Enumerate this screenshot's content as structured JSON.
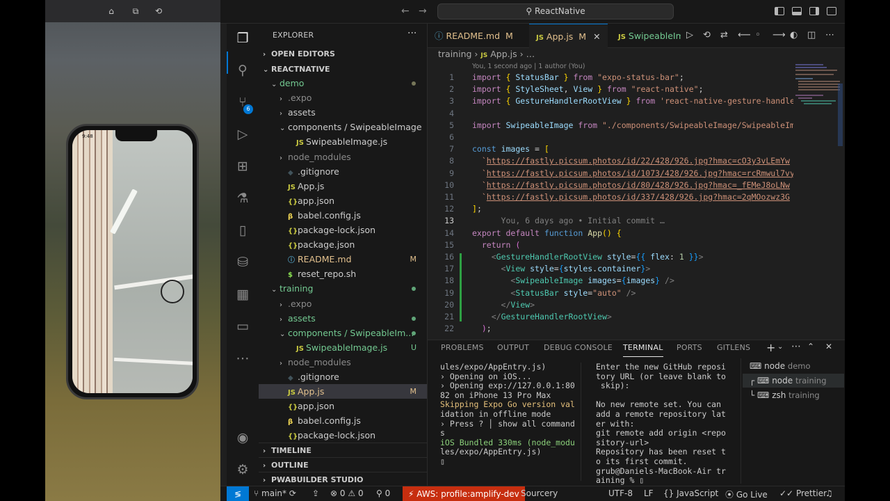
{
  "window": {
    "search_text": "ReactNative"
  },
  "simulator": {
    "status_time": "9:48"
  },
  "activity": {
    "scm_badge": "6"
  },
  "explorer": {
    "title": "EXPLORER",
    "more": "···",
    "open_editors": "OPEN EDITORS",
    "root": "REACTNATIVE",
    "rows": [
      {
        "label": "demo",
        "type": "folder",
        "open": true,
        "indent": 0,
        "color": "#73c991",
        "dot": "y"
      },
      {
        "label": ".expo",
        "type": "folder",
        "open": false,
        "indent": 1,
        "color": "#8b8b8b"
      },
      {
        "label": "assets",
        "type": "folder",
        "open": false,
        "indent": 1,
        "color": "#cccccc"
      },
      {
        "label": "components",
        "label2": " / SwipeableImage",
        "type": "folder",
        "open": true,
        "indent": 1,
        "color": "#cccccc"
      },
      {
        "label": "SwipeableImage.js",
        "type": "js",
        "indent": 2,
        "color": "#cccccc"
      },
      {
        "label": "node_modules",
        "type": "folder",
        "open": false,
        "indent": 1,
        "color": "#8b8b8b"
      },
      {
        "label": ".gitignore",
        "type": "git",
        "indent": 1,
        "color": "#cccccc"
      },
      {
        "label": "App.js",
        "type": "js",
        "indent": 1,
        "color": "#cccccc"
      },
      {
        "label": "app.json",
        "type": "json",
        "indent": 1,
        "color": "#cccccc"
      },
      {
        "label": "babel.config.js",
        "type": "babel",
        "indent": 1,
        "color": "#cccccc"
      },
      {
        "label": "package-lock.json",
        "type": "json",
        "indent": 1,
        "color": "#cccccc"
      },
      {
        "label": "package.json",
        "type": "json",
        "indent": 1,
        "color": "#cccccc"
      },
      {
        "label": "README.md",
        "type": "md",
        "indent": 1,
        "color": "#e2c08d",
        "badge": "M"
      },
      {
        "label": "reset_repo.sh",
        "type": "sh",
        "indent": 1,
        "color": "#cccccc"
      },
      {
        "label": "training",
        "type": "folder",
        "open": true,
        "indent": 0,
        "color": "#73c991",
        "dot": "g"
      },
      {
        "label": ".expo",
        "type": "folder",
        "open": false,
        "indent": 1,
        "color": "#8b8b8b"
      },
      {
        "label": "assets",
        "type": "folder",
        "open": false,
        "indent": 1,
        "color": "#73c991",
        "dot": "g"
      },
      {
        "label": "components",
        "label2": " / SwipeableIm...",
        "type": "folder",
        "open": true,
        "indent": 1,
        "color": "#73c991",
        "dot": "g"
      },
      {
        "label": "SwipeableImage.js",
        "type": "js",
        "indent": 2,
        "color": "#73c991",
        "badge": "U"
      },
      {
        "label": "node_modules",
        "type": "folder",
        "open": false,
        "indent": 1,
        "color": "#8b8b8b"
      },
      {
        "label": ".gitignore",
        "type": "git",
        "indent": 1,
        "color": "#cccccc"
      },
      {
        "label": "App.js",
        "type": "js",
        "indent": 1,
        "color": "#e2c08d",
        "badge": "M",
        "selected": true
      },
      {
        "label": "app.json",
        "type": "json",
        "indent": 1,
        "color": "#cccccc"
      },
      {
        "label": "babel.config.js",
        "type": "babel",
        "indent": 1,
        "color": "#cccccc"
      },
      {
        "label": "package-lock.json",
        "type": "json",
        "indent": 1,
        "color": "#cccccc"
      }
    ],
    "timeline": "TIMELINE",
    "outline": "OUTLINE",
    "pwabuilder": "PWABUILDER STUDIO"
  },
  "tabs": [
    {
      "label": "README.md",
      "badge": "M",
      "icon": "ⓘ",
      "icon_color": "#519aba",
      "color": "#e2c08d"
    },
    {
      "label": "App.js",
      "badge": "M",
      "icon": "JS",
      "icon_color": "#cbcb41",
      "color": "#e2c08d",
      "active": true
    },
    {
      "label": "SwipeableIm",
      "icon": "JS",
      "icon_color": "#cbcb41",
      "color": "#73c991"
    }
  ],
  "breadcrumb": {
    "folder": "training",
    "sep": "›",
    "file": "App.js",
    "tail": "…"
  },
  "blame_top": "You, 1 second ago | 1 author (You)",
  "code_lines": [
    {
      "n": "1",
      "html": "<span class='kc'>import</span> <span class='br'>{</span> <span class='var'>StatusBar</span> <span class='br'>}</span> <span class='kc'>from</span> <span class='str'>\"expo-status-bar\"</span>;"
    },
    {
      "n": "2",
      "html": "<span class='kc'>import</span> <span class='br'>{</span> <span class='var'>StyleSheet</span>, <span class='var'>View</span> <span class='br'>}</span> <span class='kc'>from</span> <span class='str'>\"react-native\"</span>;"
    },
    {
      "n": "3",
      "html": "<span class='kc'>import</span> <span class='br'>{</span> <span class='var'>GestureHandlerRootView</span> <span class='br'>}</span> <span class='kc'>from</span> <span class='str'>'react-native-gesture-handle</span>"
    },
    {
      "n": "4",
      "html": ""
    },
    {
      "n": "5",
      "html": "<span class='kc'>import</span> <span class='var'>SwipeableImage</span> <span class='kc'>from</span> <span class='str'>\"./components/SwipeableImage/SwipeableIm</span>"
    },
    {
      "n": "6",
      "html": ""
    },
    {
      "n": "7",
      "html": "<span class='kw'>const</span> <span class='var'>images</span> = <span class='br'>[</span>"
    },
    {
      "n": "8",
      "html": "  <span class='str'>`</span><span class='url'>https://fastly.picsum.photos/id/22/428/926.jpg?hmac=cO3y3vLEmYw</span>"
    },
    {
      "n": "9",
      "html": "  <span class='str'>`</span><span class='url'>https://fastly.picsum.photos/id/1073/428/926.jpg?hmac=rcRmwul7vy</span>"
    },
    {
      "n": "10",
      "html": "  <span class='str'>`</span><span class='url'>https://fastly.picsum.photos/id/80/428/926.jpg?hmac=_fEMeJ8oLNw</span>"
    },
    {
      "n": "11",
      "html": "  <span class='str'>`</span><span class='url'>https://fastly.picsum.photos/id/337/428/926.jpg?hmac=2qMOozwz3G</span>"
    },
    {
      "n": "12",
      "html": "<span class='br'>]</span>;"
    },
    {
      "n": "13",
      "html": "      <span class='pun'>You, 6 days ago • Initial commit …</span>",
      "cur": true
    },
    {
      "n": "14",
      "html": "<span class='kc'>export</span> <span class='kc'>default</span> <span class='kw'>function</span> <span class='fn'>App</span><span class='br'>()</span> <span class='br'>{</span>"
    },
    {
      "n": "15",
      "html": "  <span class='kc'>return</span> <span class='br2'>(</span>"
    },
    {
      "n": "16",
      "html": "    <span class='pun'>&lt;</span><span class='tg'>GestureHandlerRootView</span> <span class='var'>style</span>=<span class='br3'>{{</span> <span class='var'>flex</span>: <span style='color:#b5cea8'>1</span> <span class='br3'>}}</span><span class='pun'>&gt;</span>"
    },
    {
      "n": "17",
      "html": "      <span class='pun'>&lt;</span><span class='tg'>View</span> <span class='var'>style</span>=<span class='br3'>{</span><span class='var'>styles</span>.<span class='var'>container</span><span class='br3'>}</span><span class='pun'>&gt;</span>"
    },
    {
      "n": "18",
      "html": "        <span class='pun'>&lt;</span><span class='tg'>SwipeableImage</span> <span class='var'>images</span>=<span class='br3'>{</span><span class='var'>images</span><span class='br3'>}</span> <span class='pun'>/&gt;</span>"
    },
    {
      "n": "19",
      "html": "        <span class='pun'>&lt;</span><span class='tg'>StatusBar</span> <span class='var'>style</span>=<span class='str'>\"auto\"</span> <span class='pun'>/&gt;</span>"
    },
    {
      "n": "20",
      "html": "      <span class='pun'>&lt;/</span><span class='tg'>View</span><span class='pun'>&gt;</span>"
    },
    {
      "n": "21",
      "html": "    <span class='pun'>&lt;/</span><span class='tg'>GestureHandlerRootView</span><span class='pun'>&gt;</span>"
    },
    {
      "n": "22",
      "html": "  <span class='br2'>)</span>;"
    }
  ],
  "panel": {
    "tabs": [
      "PROBLEMS",
      "OUTPUT",
      "DEBUG CONSOLE",
      "TERMINAL",
      "PORTS",
      "GITLENS"
    ],
    "active_tab": "TERMINAL",
    "left_terminal": [
      "ules/expo/AppEntry.js)",
      "› Opening on iOS...",
      "› Opening exp://127.0.0.1:80",
      "82 on iPhone 13 Pro Max",
      "Skipping Expo Go version val",
      "idation in offline mode",
      "› Press ? │ show all command",
      "s",
      "iOS Bundled 330ms (node_modu",
      "les/expo/AppEntry.js)",
      "▯"
    ],
    "right_terminal": [
      "Enter the new GitHub reposi",
      "tory URL (or leave blank to",
      " skip):",
      "",
      "No new remote set. You can",
      "add a remote repository lat",
      "er with:",
      "git remote add origin <repo",
      "sitory-url>",
      "Repository has been reset t",
      "o its first commit.",
      "grub@Daniels-MacBook-Air tr",
      "aining % ▯"
    ],
    "terminals": [
      {
        "name": "node",
        "sub": "demo"
      },
      {
        "name": "node",
        "sub": "training",
        "selected": true
      },
      {
        "name": "zsh",
        "sub": "training"
      }
    ]
  },
  "status": {
    "branch": "main*",
    "errors": "0",
    "warnings": "0",
    "ports": "0",
    "aws": "AWS: profile:amplify-dev",
    "sourcery": "Sourcery",
    "encoding": "UTF-8",
    "eol": "LF",
    "language": "JavaScript",
    "golive": "Go Live",
    "prettier": "Prettier"
  }
}
